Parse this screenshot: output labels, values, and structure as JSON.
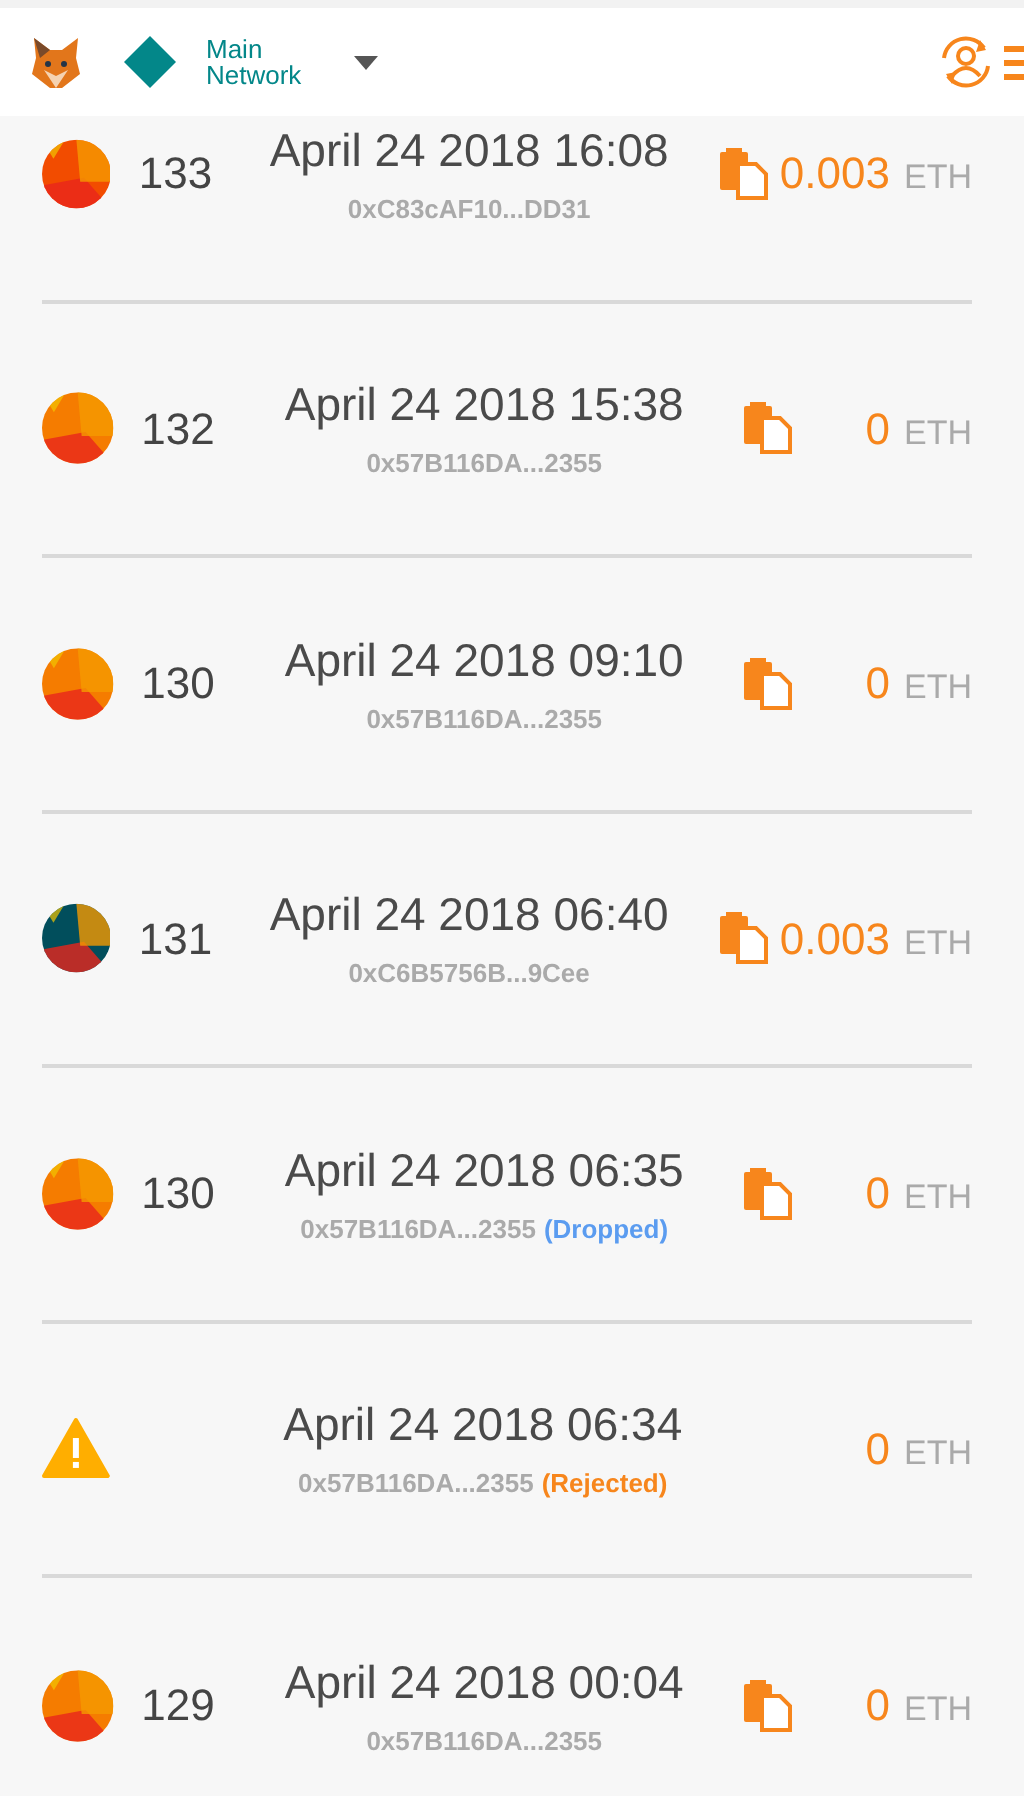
{
  "header": {
    "network": "Main Network"
  },
  "transactions": [
    {
      "kind": "identicon",
      "color": "#f24c00",
      "nonce": "133",
      "date": "April 24 2018 16:08",
      "address": "0xC83cAF10...DD31",
      "copyable": true,
      "amount": "0.003",
      "unit": "ETH"
    },
    {
      "kind": "identicon",
      "color": "#f57c00",
      "nonce": "132",
      "date": "April 24 2018 15:38",
      "address": "0x57B116DA...2355",
      "copyable": true,
      "amount": "0",
      "unit": "ETH"
    },
    {
      "kind": "identicon",
      "color": "#f57c00",
      "nonce": "130",
      "date": "April 24 2018 09:10",
      "address": "0x57B116DA...2355",
      "copyable": true,
      "amount": "0",
      "unit": "ETH"
    },
    {
      "kind": "identicon",
      "color": "#014e5c",
      "nonce": "131",
      "date": "April 24 2018 06:40",
      "address": "0xC6B5756B...9Cee",
      "copyable": true,
      "amount": "0.003",
      "unit": "ETH"
    },
    {
      "kind": "identicon",
      "color": "#f57c00",
      "nonce": "130",
      "date": "April 24 2018 06:35",
      "address": "0x57B116DA...2355",
      "status": {
        "kind": "dropped",
        "text": "(Dropped)"
      },
      "copyable": true,
      "amount": "0",
      "unit": "ETH"
    },
    {
      "kind": "warning",
      "date": "April 24 2018 06:34",
      "address": "0x57B116DA...2355",
      "status": {
        "kind": "rejected",
        "text": "(Rejected)"
      },
      "copyable": false,
      "amount": "0",
      "unit": "ETH"
    },
    {
      "kind": "identicon",
      "color": "#f57c00",
      "nonce": "129",
      "date": "April 24 2018 00:04",
      "address": "0x57B116DA...2355",
      "copyable": true,
      "amount": "0",
      "unit": "ETH"
    }
  ]
}
